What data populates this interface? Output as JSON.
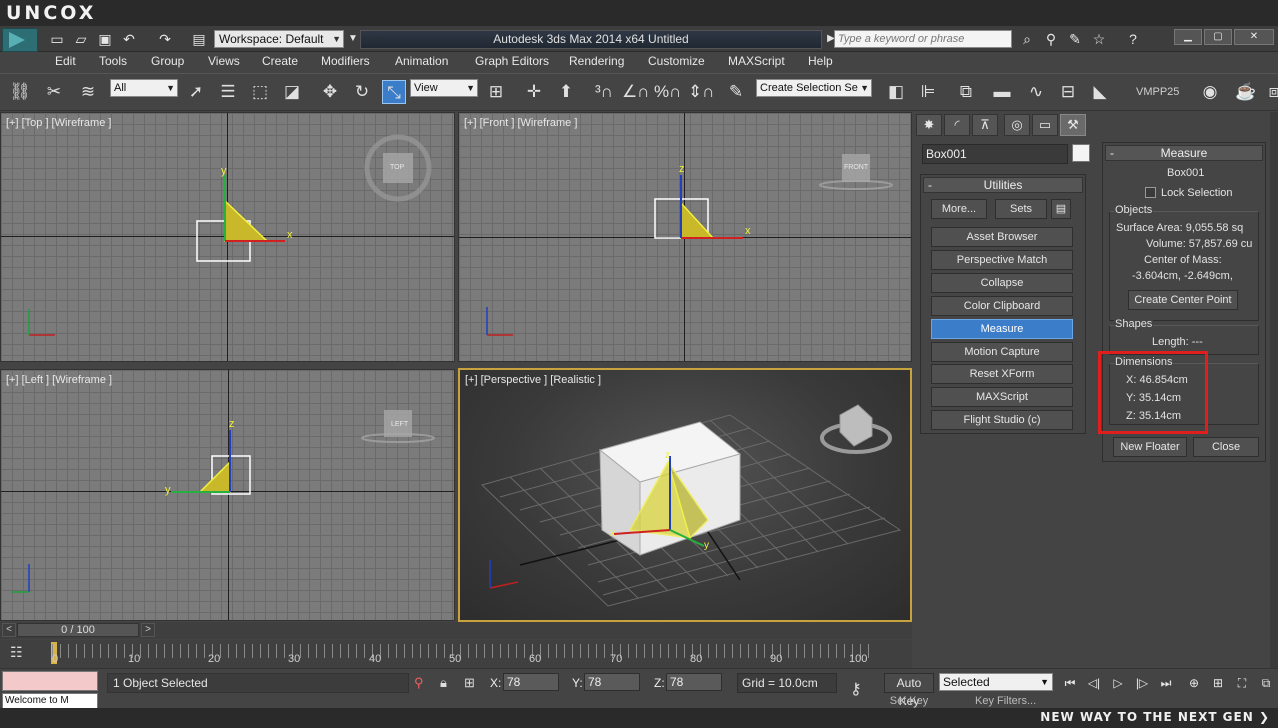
{
  "brand": {
    "logo": "UNCOX"
  },
  "titlebar": {
    "workspace": "Workspace: Default",
    "app_title": "Autodesk 3ds Max  2014 x64      Untitled",
    "search_placeholder": "Type a keyword or phrase"
  },
  "menu": [
    "Edit",
    "Tools",
    "Group",
    "Views",
    "Create",
    "Modifiers",
    "Animation",
    "Graph Editors",
    "Rendering",
    "Customize",
    "MAXScript",
    "Help"
  ],
  "toolbar": {
    "filter": "All",
    "ref_coord": "View",
    "selection_set": "Create Selection Se",
    "vmpp": "VMPP25"
  },
  "viewports": {
    "top": "[+] [Top ] [Wireframe ]",
    "front": "[+] [Front ] [Wireframe ]",
    "left": "[+] [Left ] [Wireframe ]",
    "persp": "[+] [Perspective ] [Realistic ]"
  },
  "viewcube": {
    "top": "TOP",
    "front": "FRONT",
    "left": "LEFT"
  },
  "axes": {
    "x": "x",
    "y": "y",
    "z": "z"
  },
  "timeline": {
    "frame": "0 / 100",
    "ticks": [
      "0",
      "10",
      "20",
      "30",
      "40",
      "50",
      "60",
      "70",
      "80",
      "90",
      "100"
    ]
  },
  "status": {
    "selection": "1 Object Selected",
    "x_label": "X:",
    "x_value": "78",
    "y_label": "Y:",
    "y_value": "78",
    "z_label": "Z:",
    "z_value": "78",
    "grid": "Grid = 10.0cm",
    "auto_key": "Auto Key",
    "set_key": "Set Key",
    "key_mode": "Selected",
    "key_filters": "Key Filters...",
    "maxscript_text": "Welcome to M"
  },
  "command_panel": {
    "object_name": "Box001",
    "utilities_title": "Utilities",
    "more": "More...",
    "sets": "Sets",
    "buttons": [
      "Asset Browser",
      "Perspective Match",
      "Collapse",
      "Color Clipboard",
      "Measure",
      "Motion Capture",
      "Reset XForm",
      "MAXScript",
      "Flight Studio (c)"
    ],
    "active": "Measure"
  },
  "measure": {
    "title": "Measure",
    "object": "Box001",
    "lock_selection": "Lock Selection",
    "objects_group": "Objects",
    "surface_area": "Surface Area:  9,055.58 sq",
    "volume": "Volume:  57,857.69 cu",
    "center_mass_label": "Center of Mass:",
    "center_mass_value": "-3.604cm, -2.649cm,",
    "create_center": "Create Center Point",
    "shapes_group": "Shapes",
    "length": "Length:  ---",
    "dimensions_group": "Dimensions",
    "dim_x": "X:  46.854cm",
    "dim_y": "Y:  35.14cm",
    "dim_z": "Z:  35.14cm",
    "new_floater": "New Floater",
    "close": "Close"
  },
  "banner": {
    "text": "NEW WAY TO THE NEXT GEN ❯"
  },
  "colors": {
    "highlight": "#e01e1e",
    "active_button": "#3c7dc9",
    "viewport_active": "#c8a23c",
    "selection_yellow": "#e6e62e"
  }
}
